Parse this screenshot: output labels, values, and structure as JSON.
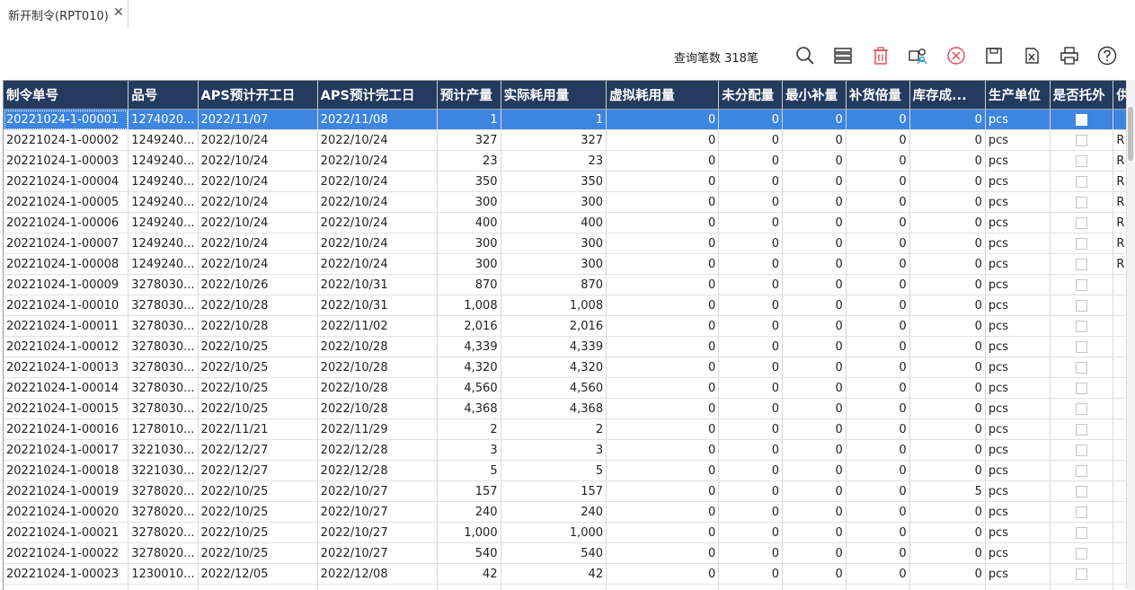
{
  "tab": {
    "title": "新开制令(RPT010)",
    "close_glyph": "✕"
  },
  "toolbar": {
    "count_label": "查询笔数 318笔",
    "buttons": [
      {
        "name": "search",
        "icon": "search-icon"
      },
      {
        "name": "layout",
        "icon": "list-icon"
      },
      {
        "name": "delete",
        "icon": "trash-icon"
      },
      {
        "name": "user-settings",
        "icon": "user-gear-icon"
      },
      {
        "name": "cancel",
        "icon": "cancel-circle-icon"
      },
      {
        "name": "save",
        "icon": "save-icon"
      },
      {
        "name": "export",
        "icon": "export-file-icon"
      },
      {
        "name": "print",
        "icon": "printer-icon"
      },
      {
        "name": "help",
        "icon": "help-icon"
      }
    ],
    "delete_color": "#e0505a",
    "cancel_color": "#e0505a"
  },
  "grid": {
    "header_color": "#243a5e",
    "selected_color": "#3d85de",
    "columns": [
      "制令单号",
      "品号",
      "APS预计开工日",
      "APS预计完工日",
      "预计产量",
      "实际耗用量",
      "虚拟耗用量",
      "未分配量",
      "最小补量",
      "补货倍量",
      "库存成...",
      "生产单位",
      "是否托外",
      "供"
    ],
    "rows": [
      [
        "20221024-1-00001",
        "1274020...",
        "2022/11/07",
        "2022/11/08",
        "1",
        "1",
        "0",
        "0",
        "0",
        "0",
        "0",
        "pcs",
        "",
        ""
      ],
      [
        "20221024-1-00002",
        "1249240...",
        "2022/10/24",
        "2022/10/24",
        "327",
        "327",
        "0",
        "0",
        "0",
        "0",
        "0",
        "pcs",
        "",
        "R"
      ],
      [
        "20221024-1-00003",
        "1249240...",
        "2022/10/24",
        "2022/10/24",
        "23",
        "23",
        "0",
        "0",
        "0",
        "0",
        "0",
        "pcs",
        "",
        "R"
      ],
      [
        "20221024-1-00004",
        "1249240...",
        "2022/10/24",
        "2022/10/24",
        "350",
        "350",
        "0",
        "0",
        "0",
        "0",
        "0",
        "pcs",
        "",
        "R"
      ],
      [
        "20221024-1-00005",
        "1249240...",
        "2022/10/24",
        "2022/10/24",
        "300",
        "300",
        "0",
        "0",
        "0",
        "0",
        "0",
        "pcs",
        "",
        "R"
      ],
      [
        "20221024-1-00006",
        "1249240...",
        "2022/10/24",
        "2022/10/24",
        "400",
        "400",
        "0",
        "0",
        "0",
        "0",
        "0",
        "pcs",
        "",
        "R"
      ],
      [
        "20221024-1-00007",
        "1249240...",
        "2022/10/24",
        "2022/10/24",
        "300",
        "300",
        "0",
        "0",
        "0",
        "0",
        "0",
        "pcs",
        "",
        "R"
      ],
      [
        "20221024-1-00008",
        "1249240...",
        "2022/10/24",
        "2022/10/24",
        "300",
        "300",
        "0",
        "0",
        "0",
        "0",
        "0",
        "pcs",
        "",
        "R"
      ],
      [
        "20221024-1-00009",
        "3278030...",
        "2022/10/26",
        "2022/10/31",
        "870",
        "870",
        "0",
        "0",
        "0",
        "0",
        "0",
        "pcs",
        "",
        ""
      ],
      [
        "20221024-1-00010",
        "3278030...",
        "2022/10/28",
        "2022/10/31",
        "1,008",
        "1,008",
        "0",
        "0",
        "0",
        "0",
        "0",
        "pcs",
        "",
        ""
      ],
      [
        "20221024-1-00011",
        "3278030...",
        "2022/10/28",
        "2022/11/02",
        "2,016",
        "2,016",
        "0",
        "0",
        "0",
        "0",
        "0",
        "pcs",
        "",
        ""
      ],
      [
        "20221024-1-00012",
        "3278030...",
        "2022/10/25",
        "2022/10/28",
        "4,339",
        "4,339",
        "0",
        "0",
        "0",
        "0",
        "0",
        "pcs",
        "",
        ""
      ],
      [
        "20221024-1-00013",
        "3278030...",
        "2022/10/25",
        "2022/10/28",
        "4,320",
        "4,320",
        "0",
        "0",
        "0",
        "0",
        "0",
        "pcs",
        "",
        ""
      ],
      [
        "20221024-1-00014",
        "3278030...",
        "2022/10/25",
        "2022/10/28",
        "4,560",
        "4,560",
        "0",
        "0",
        "0",
        "0",
        "0",
        "pcs",
        "",
        ""
      ],
      [
        "20221024-1-00015",
        "3278030...",
        "2022/10/25",
        "2022/10/28",
        "4,368",
        "4,368",
        "0",
        "0",
        "0",
        "0",
        "0",
        "pcs",
        "",
        ""
      ],
      [
        "20221024-1-00016",
        "1278010...",
        "2022/11/21",
        "2022/11/29",
        "2",
        "2",
        "0",
        "0",
        "0",
        "0",
        "0",
        "pcs",
        "",
        ""
      ],
      [
        "20221024-1-00017",
        "3221030...",
        "2022/12/27",
        "2022/12/28",
        "3",
        "3",
        "0",
        "0",
        "0",
        "0",
        "0",
        "pcs",
        "",
        ""
      ],
      [
        "20221024-1-00018",
        "3221030...",
        "2022/12/27",
        "2022/12/28",
        "5",
        "5",
        "0",
        "0",
        "0",
        "0",
        "0",
        "pcs",
        "",
        ""
      ],
      [
        "20221024-1-00019",
        "3278020...",
        "2022/10/25",
        "2022/10/27",
        "157",
        "157",
        "0",
        "0",
        "0",
        "0",
        "5",
        "pcs",
        "",
        ""
      ],
      [
        "20221024-1-00020",
        "3278020...",
        "2022/10/25",
        "2022/10/27",
        "240",
        "240",
        "0",
        "0",
        "0",
        "0",
        "0",
        "pcs",
        "",
        ""
      ],
      [
        "20221024-1-00021",
        "3278020...",
        "2022/10/25",
        "2022/10/27",
        "1,000",
        "1,000",
        "0",
        "0",
        "0",
        "0",
        "0",
        "pcs",
        "",
        ""
      ],
      [
        "20221024-1-00022",
        "3278020...",
        "2022/10/25",
        "2022/10/27",
        "540",
        "540",
        "0",
        "0",
        "0",
        "0",
        "0",
        "pcs",
        "",
        ""
      ],
      [
        "20221024-1-00023",
        "1230010...",
        "2022/12/05",
        "2022/12/08",
        "42",
        "42",
        "0",
        "0",
        "0",
        "0",
        "0",
        "pcs",
        "",
        ""
      ],
      [
        "",
        "",
        "",
        "",
        "",
        "",
        "",
        "",
        "",
        "",
        "",
        "",
        "",
        ""
      ]
    ],
    "selected_row": 0
  }
}
